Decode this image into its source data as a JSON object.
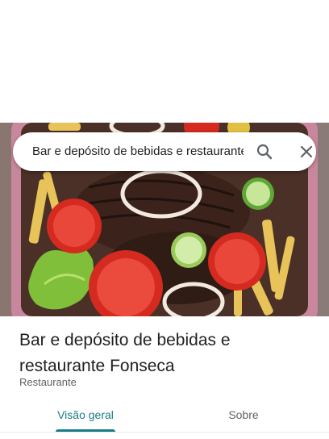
{
  "search": {
    "query": "Bar e depósito de bebidas e restaurante Fonseca",
    "search_icon": "search-icon",
    "close_icon": "close-icon"
  },
  "hero": {
    "photo": "food-photo"
  },
  "place": {
    "name": "Bar e depósito de bebidas e restaurante Fonseca",
    "category": "Restaurante"
  },
  "tabs": [
    {
      "label": "Visão geral",
      "active": true
    },
    {
      "label": "Sobre",
      "active": false
    }
  ],
  "colors": {
    "accent": "#1a7d86",
    "text_primary": "#202124",
    "text_secondary": "#5f6368"
  }
}
